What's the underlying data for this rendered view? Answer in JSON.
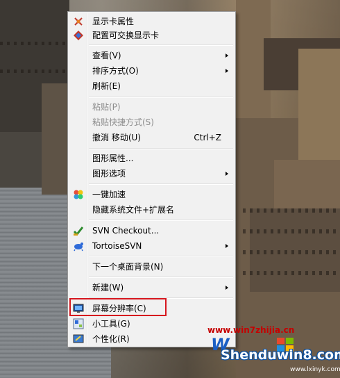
{
  "menu": {
    "items": [
      {
        "label": "显示卡属性",
        "icon": "display-adapter-icon"
      },
      {
        "label": "配置可交换显示卡",
        "icon": "switchable-graphics-icon"
      },
      {
        "label": "查看(V)",
        "submenu": true
      },
      {
        "label": "排序方式(O)",
        "submenu": true
      },
      {
        "label": "刷新(E)"
      },
      {
        "label": "粘贴(P)",
        "disabled": true
      },
      {
        "label": "粘贴快捷方式(S)",
        "disabled": true
      },
      {
        "label": "撤消 移动(U)",
        "shortcut": "Ctrl+Z"
      },
      {
        "label": "图形属性..."
      },
      {
        "label": "图形选项",
        "submenu": true
      },
      {
        "label": "一键加速",
        "icon": "speedup-icon"
      },
      {
        "label": "隐藏系统文件+扩展名"
      },
      {
        "label": "SVN Checkout...",
        "icon": "svn-checkout-icon"
      },
      {
        "label": "TortoiseSVN",
        "icon": "tortoise-icon",
        "submenu": true
      },
      {
        "label": "下一个桌面背景(N)"
      },
      {
        "label": "新建(W)",
        "submenu": true
      },
      {
        "label": "屏幕分辨率(C)",
        "icon": "screen-resolution-icon",
        "highlighted": true
      },
      {
        "label": "小工具(G)",
        "icon": "gadgets-icon"
      },
      {
        "label": "个性化(R)",
        "icon": "personalize-icon"
      }
    ]
  },
  "highlight_color": "#d6161e",
  "watermark": {
    "url": "www.win7zhijia.cn",
    "logo_letter": "W",
    "brand": "Shenduwin8.com",
    "url2": "www.lxinyk.com"
  }
}
